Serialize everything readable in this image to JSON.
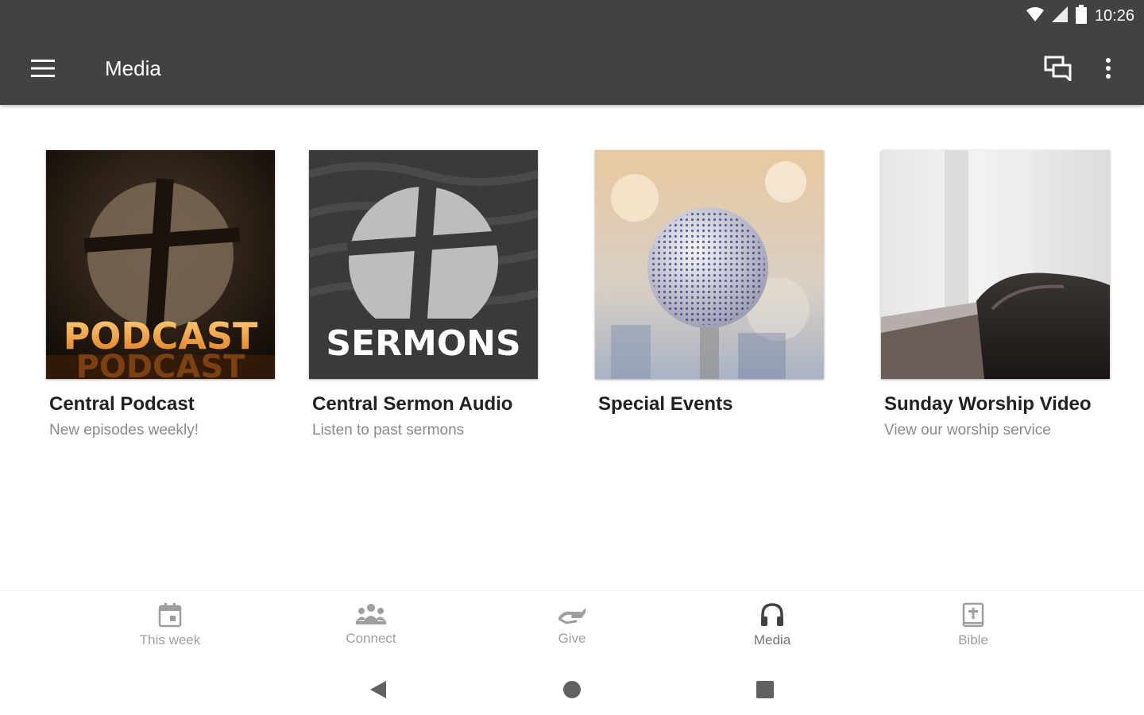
{
  "status_bar": {
    "time": "10:26",
    "icons": [
      "wifi-icon",
      "signal-icon",
      "battery-icon"
    ]
  },
  "app_bar": {
    "title": "Media",
    "icons": [
      "menu-icon",
      "chat-icon",
      "more-vert-icon"
    ],
    "background": "#424242"
  },
  "cards": [
    {
      "title": "Central Podcast",
      "subtitle": "New episodes weekly!",
      "thumb_text": "PODCAST",
      "image": "podcast-artwork"
    },
    {
      "title": "Central Sermon Audio",
      "subtitle": "Listen to past sermons",
      "thumb_text": "SERMONS",
      "image": "sermons-artwork"
    },
    {
      "title": "Special Events",
      "subtitle": "",
      "image": "microphone-photo"
    },
    {
      "title": "Sunday Worship Video",
      "subtitle": "View our worship service",
      "image": "bible-photo"
    }
  ],
  "bottom_nav": {
    "items": [
      {
        "label": "This week",
        "icon": "calendar-icon"
      },
      {
        "label": "Connect",
        "icon": "group-icon"
      },
      {
        "label": "Give",
        "icon": "give-hand-icon"
      },
      {
        "label": "Media",
        "icon": "headphones-icon",
        "active": true
      },
      {
        "label": "Bible",
        "icon": "bible-icon"
      }
    ]
  },
  "system_nav": [
    "back-icon",
    "home-icon",
    "recents-icon"
  ]
}
